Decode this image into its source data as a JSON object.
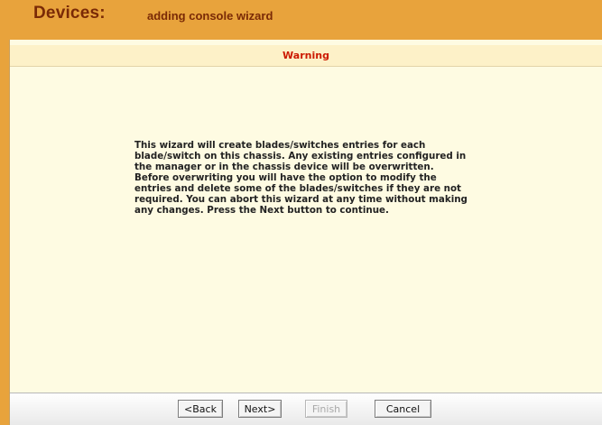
{
  "header": {
    "title": "Devices:",
    "subtitle": "adding console wizard"
  },
  "dialog": {
    "heading": "Warning",
    "message_lines": [
      "This wizard will create blades/switches entries for each",
      "blade/switch on this chassis. Any existing entries configured in",
      "the manager or in the chassis device will be overwritten.",
      "Before overwriting you will have the option to modify the",
      "entries and delete some of the blades/switches if they are not",
      "required. You can abort this wizard at any time without making",
      "any changes. Press the Next button to continue."
    ]
  },
  "buttons": {
    "back": "<Back",
    "next": "Next>",
    "finish": "Finish",
    "cancel": "Cancel"
  },
  "colors": {
    "header_background": "#e8a33c",
    "header_text": "#7a2a06",
    "dialog_background": "#fefbe2",
    "warning_text": "#cc1a00"
  }
}
